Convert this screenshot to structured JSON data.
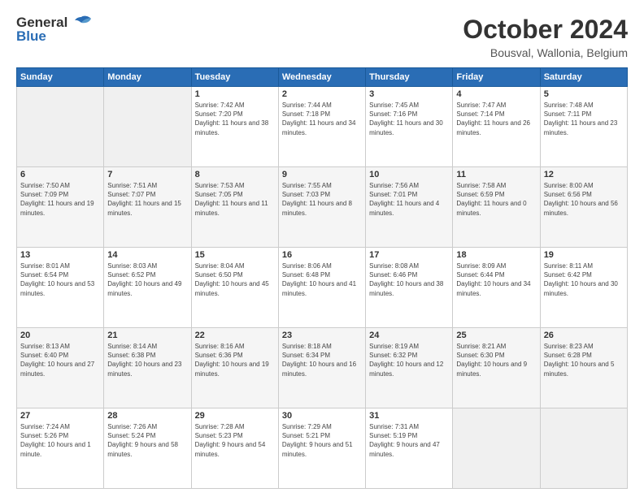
{
  "header": {
    "logo_general": "General",
    "logo_blue": "Blue",
    "month_title": "October 2024",
    "location": "Bousval, Wallonia, Belgium"
  },
  "days_of_week": [
    "Sunday",
    "Monday",
    "Tuesday",
    "Wednesday",
    "Thursday",
    "Friday",
    "Saturday"
  ],
  "weeks": [
    [
      {
        "day": "",
        "info": ""
      },
      {
        "day": "",
        "info": ""
      },
      {
        "day": "1",
        "info": "Sunrise: 7:42 AM\nSunset: 7:20 PM\nDaylight: 11 hours and 38 minutes."
      },
      {
        "day": "2",
        "info": "Sunrise: 7:44 AM\nSunset: 7:18 PM\nDaylight: 11 hours and 34 minutes."
      },
      {
        "day": "3",
        "info": "Sunrise: 7:45 AM\nSunset: 7:16 PM\nDaylight: 11 hours and 30 minutes."
      },
      {
        "day": "4",
        "info": "Sunrise: 7:47 AM\nSunset: 7:14 PM\nDaylight: 11 hours and 26 minutes."
      },
      {
        "day": "5",
        "info": "Sunrise: 7:48 AM\nSunset: 7:11 PM\nDaylight: 11 hours and 23 minutes."
      }
    ],
    [
      {
        "day": "6",
        "info": "Sunrise: 7:50 AM\nSunset: 7:09 PM\nDaylight: 11 hours and 19 minutes."
      },
      {
        "day": "7",
        "info": "Sunrise: 7:51 AM\nSunset: 7:07 PM\nDaylight: 11 hours and 15 minutes."
      },
      {
        "day": "8",
        "info": "Sunrise: 7:53 AM\nSunset: 7:05 PM\nDaylight: 11 hours and 11 minutes."
      },
      {
        "day": "9",
        "info": "Sunrise: 7:55 AM\nSunset: 7:03 PM\nDaylight: 11 hours and 8 minutes."
      },
      {
        "day": "10",
        "info": "Sunrise: 7:56 AM\nSunset: 7:01 PM\nDaylight: 11 hours and 4 minutes."
      },
      {
        "day": "11",
        "info": "Sunrise: 7:58 AM\nSunset: 6:59 PM\nDaylight: 11 hours and 0 minutes."
      },
      {
        "day": "12",
        "info": "Sunrise: 8:00 AM\nSunset: 6:56 PM\nDaylight: 10 hours and 56 minutes."
      }
    ],
    [
      {
        "day": "13",
        "info": "Sunrise: 8:01 AM\nSunset: 6:54 PM\nDaylight: 10 hours and 53 minutes."
      },
      {
        "day": "14",
        "info": "Sunrise: 8:03 AM\nSunset: 6:52 PM\nDaylight: 10 hours and 49 minutes."
      },
      {
        "day": "15",
        "info": "Sunrise: 8:04 AM\nSunset: 6:50 PM\nDaylight: 10 hours and 45 minutes."
      },
      {
        "day": "16",
        "info": "Sunrise: 8:06 AM\nSunset: 6:48 PM\nDaylight: 10 hours and 41 minutes."
      },
      {
        "day": "17",
        "info": "Sunrise: 8:08 AM\nSunset: 6:46 PM\nDaylight: 10 hours and 38 minutes."
      },
      {
        "day": "18",
        "info": "Sunrise: 8:09 AM\nSunset: 6:44 PM\nDaylight: 10 hours and 34 minutes."
      },
      {
        "day": "19",
        "info": "Sunrise: 8:11 AM\nSunset: 6:42 PM\nDaylight: 10 hours and 30 minutes."
      }
    ],
    [
      {
        "day": "20",
        "info": "Sunrise: 8:13 AM\nSunset: 6:40 PM\nDaylight: 10 hours and 27 minutes."
      },
      {
        "day": "21",
        "info": "Sunrise: 8:14 AM\nSunset: 6:38 PM\nDaylight: 10 hours and 23 minutes."
      },
      {
        "day": "22",
        "info": "Sunrise: 8:16 AM\nSunset: 6:36 PM\nDaylight: 10 hours and 19 minutes."
      },
      {
        "day": "23",
        "info": "Sunrise: 8:18 AM\nSunset: 6:34 PM\nDaylight: 10 hours and 16 minutes."
      },
      {
        "day": "24",
        "info": "Sunrise: 8:19 AM\nSunset: 6:32 PM\nDaylight: 10 hours and 12 minutes."
      },
      {
        "day": "25",
        "info": "Sunrise: 8:21 AM\nSunset: 6:30 PM\nDaylight: 10 hours and 9 minutes."
      },
      {
        "day": "26",
        "info": "Sunrise: 8:23 AM\nSunset: 6:28 PM\nDaylight: 10 hours and 5 minutes."
      }
    ],
    [
      {
        "day": "27",
        "info": "Sunrise: 7:24 AM\nSunset: 5:26 PM\nDaylight: 10 hours and 1 minute."
      },
      {
        "day": "28",
        "info": "Sunrise: 7:26 AM\nSunset: 5:24 PM\nDaylight: 9 hours and 58 minutes."
      },
      {
        "day": "29",
        "info": "Sunrise: 7:28 AM\nSunset: 5:23 PM\nDaylight: 9 hours and 54 minutes."
      },
      {
        "day": "30",
        "info": "Sunrise: 7:29 AM\nSunset: 5:21 PM\nDaylight: 9 hours and 51 minutes."
      },
      {
        "day": "31",
        "info": "Sunrise: 7:31 AM\nSunset: 5:19 PM\nDaylight: 9 hours and 47 minutes."
      },
      {
        "day": "",
        "info": ""
      },
      {
        "day": "",
        "info": ""
      }
    ]
  ]
}
